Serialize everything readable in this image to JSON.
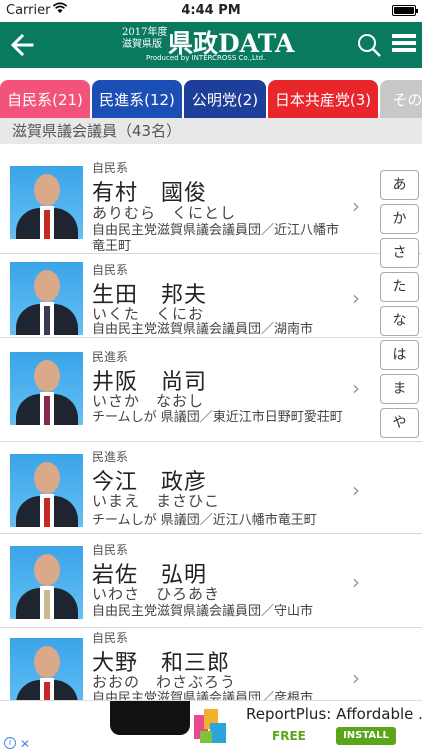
{
  "status_bar": {
    "carrier": "Carrier",
    "time": "4:44 PM"
  },
  "header": {
    "logo_small_line1": "2017年度",
    "logo_small_line2": "滋賀県版",
    "logo_big": "県政DATA",
    "logo_produced": "Produced by INTERCROSS Co.,Ltd.",
    "color": "#0a7a5e"
  },
  "tabs": [
    {
      "label": "自民系(21)",
      "color": "#f3537a"
    },
    {
      "label": "民進系(12)",
      "color": "#1b4fb5"
    },
    {
      "label": "公明党(2)",
      "color": "#1d3f9a"
    },
    {
      "label": "日本共産党(3)",
      "color": "#e8262c"
    },
    {
      "label": "その他",
      "color": "#c8c8c8"
    }
  ],
  "section": {
    "title": "滋賀県議会議員（43名）"
  },
  "members": [
    {
      "faction": "自民系",
      "name": "有村　國俊",
      "kana": "ありむら　くにとし",
      "affiliation": "自由民主党滋賀県議会議員団／近江八幡市竜王町"
    },
    {
      "faction": "自民系",
      "name": "生田　邦夫",
      "kana": "いくた　くにお",
      "affiliation": "自由民主党滋賀県議会議員団／湖南市"
    },
    {
      "faction": "民進系",
      "name": "井阪　尚司",
      "kana": "いさか　なおし",
      "affiliation": "チームしが 県議団／東近江市日野町愛荘町"
    },
    {
      "faction": "民進系",
      "name": "今江　政彦",
      "kana": "いまえ　まさひこ",
      "affiliation": "チームしが 県議団／近江八幡市竜王町"
    },
    {
      "faction": "自民系",
      "name": "岩佐　弘明",
      "kana": "いわさ　ひろあき",
      "affiliation": "自由民主党滋賀県議会議員団／守山市"
    },
    {
      "faction": "自民系",
      "name": "大野　和三郎",
      "kana": "おおの　わさぶろう",
      "affiliation": "自由民主党滋賀県議会議員団／彦根市"
    }
  ],
  "index_keys": [
    "あ",
    "か",
    "さ",
    "た",
    "な",
    "は",
    "ま",
    "や"
  ],
  "ad": {
    "title": "ReportPlus: Affordable ...",
    "free": "FREE",
    "install": "INSTALL"
  }
}
